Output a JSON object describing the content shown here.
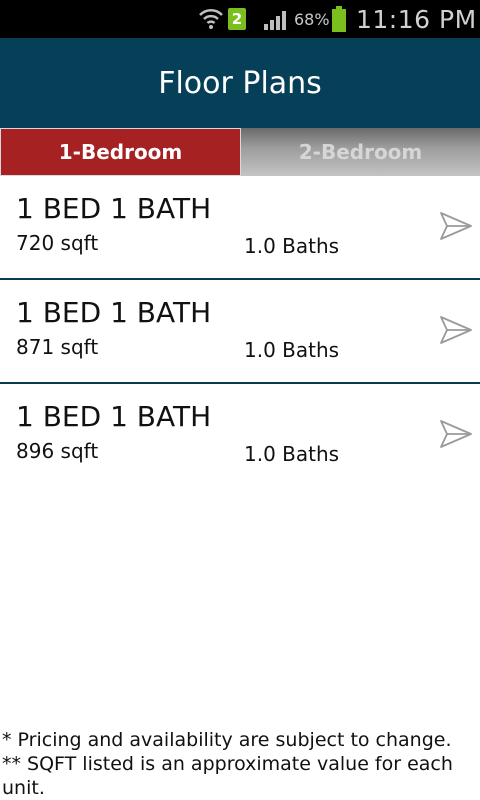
{
  "status_bar": {
    "notification_count": "2",
    "battery_percent": "68%",
    "time": "11:16 PM",
    "icons": [
      "wifi-icon",
      "notification-badge",
      "signal-icon",
      "battery-icon"
    ]
  },
  "app_bar": {
    "title": "Floor Plans"
  },
  "tabs": [
    {
      "label": "1-Bedroom",
      "selected": true
    },
    {
      "label": "2-Bedroom",
      "selected": false
    }
  ],
  "floor_plans": [
    {
      "title": "1 BED 1 BATH",
      "sqft": "720 sqft",
      "baths": "1.0 Baths"
    },
    {
      "title": "1 BED 1 BATH",
      "sqft": "871 sqft",
      "baths": "1.0 Baths"
    },
    {
      "title": "1 BED 1 BATH",
      "sqft": "896 sqft",
      "baths": "1.0 Baths"
    }
  ],
  "notes": {
    "line1": "* Pricing and availability are subject to change.",
    "line2": "** SQFT listed is an approximate value for each unit."
  },
  "colors": {
    "app_bar_bg": "#063f58",
    "tab_active_bg": "#a52122",
    "row_divider": "#0b3b50"
  }
}
